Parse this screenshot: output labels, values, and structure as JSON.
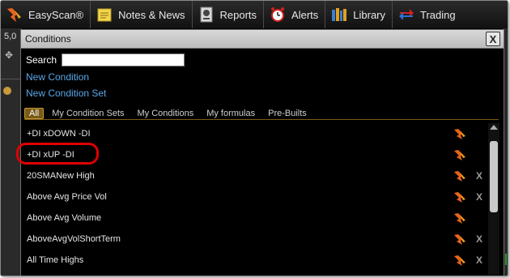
{
  "toolbar": {
    "items": [
      {
        "label": "EasyScan®",
        "icon": "easyscan-icon"
      },
      {
        "label": "Notes & News",
        "icon": "notes-icon"
      },
      {
        "label": "Reports",
        "icon": "reports-icon"
      },
      {
        "label": "Alerts",
        "icon": "alarm-clock-icon"
      },
      {
        "label": "Library",
        "icon": "library-icon"
      },
      {
        "label": "Trading",
        "icon": "trading-icon"
      }
    ]
  },
  "background": {
    "left_value": "5,0"
  },
  "dialog": {
    "title": "Conditions",
    "close_label": "X",
    "search": {
      "label": "Search",
      "value": ""
    },
    "links": {
      "new_condition": "New Condition",
      "new_condition_set": "New Condition Set"
    },
    "tabs": [
      "All",
      "My Condition Sets",
      "My Conditions",
      "My formulas",
      "Pre-Builts"
    ],
    "active_tab": "All",
    "conditions": [
      {
        "label": "+DI xDOWN -DI",
        "deletable": false
      },
      {
        "label": "+DI xUP -DI",
        "deletable": false
      },
      {
        "label": "20SMANew High",
        "deletable": true
      },
      {
        "label": "Above Avg Price Vol",
        "deletable": true
      },
      {
        "label": "Above Avg Volume",
        "deletable": false
      },
      {
        "label": "AboveAvgVolShortTerm",
        "deletable": true
      },
      {
        "label": "All Time Highs",
        "deletable": true
      }
    ],
    "delete_label": "X"
  },
  "colors": {
    "link": "#5aa7e8",
    "highlight": "#e00000",
    "active_tab": "#7a5a18",
    "dialog_bg": "#000000"
  }
}
